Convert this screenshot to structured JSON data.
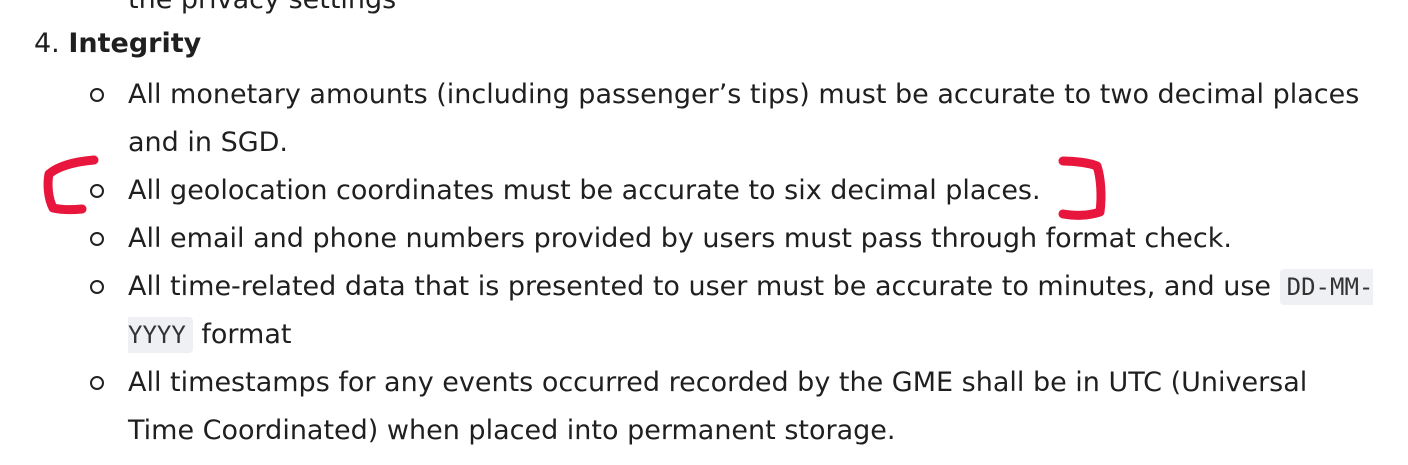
{
  "previous_line": "the privacy settings",
  "section": {
    "number": "4.",
    "title": "Integrity",
    "items": [
      {
        "text": "All monetary amounts (including passenger’s tips) must be accurate to two decimal places and in SGD."
      },
      {
        "text": "All geolocation coordinates must be accurate to six decimal places."
      },
      {
        "text": "All email and phone numbers provided by users must pass through format check."
      },
      {
        "text_before": "All time-related data that is presented to user must be accurate to minutes, and use ",
        "code": "DD-MM-YYYY",
        "text_after": " format"
      },
      {
        "text": "All timestamps for any events occurred recorded by the GME shall be in UTC (Universal Time Coordinated) when placed into permanent storage."
      }
    ]
  },
  "annotation_color": "#e8163c"
}
